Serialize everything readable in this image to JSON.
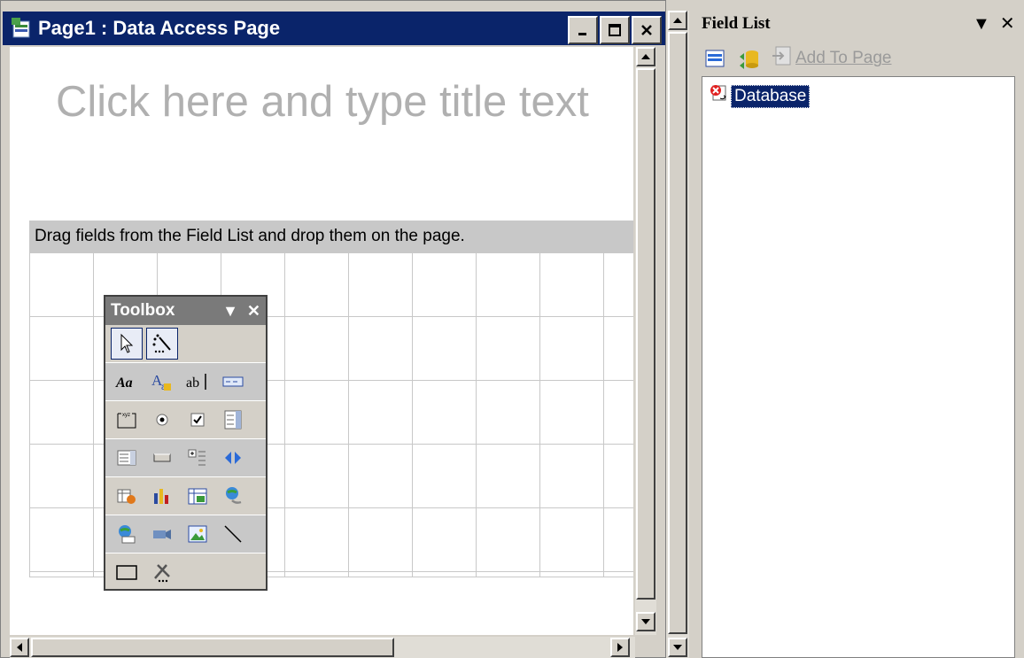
{
  "doc_window": {
    "title": "Page1 : Data Access Page",
    "title_placeholder": "Click here and type title text",
    "section_header": "Drag fields from the Field List and drop them on the page."
  },
  "toolbox": {
    "title": "Toolbox",
    "tools": [
      [
        "pointer-icon",
        "control-wizards-icon"
      ],
      [
        "label-icon",
        "bound-span-icon",
        "text-box-icon",
        "scrolling-text-icon"
      ],
      [
        "group-box-icon",
        "option-button-icon",
        "check-box-icon",
        "dropdown-list-icon"
      ],
      [
        "list-box-icon",
        "command-button-icon",
        "expand-icon",
        "record-navigation-icon"
      ],
      [
        "office-pivottable-icon",
        "office-chart-icon",
        "office-spreadsheet-icon",
        "hyperlink-icon"
      ],
      [
        "image-hyperlink-icon",
        "movie-icon",
        "image-icon",
        "line-icon"
      ],
      [
        "rectangle-icon",
        "more-controls-icon"
      ]
    ]
  },
  "field_list": {
    "title": "Field List",
    "add_to_page": "Add To Page",
    "tree": [
      {
        "label": "Database"
      }
    ]
  },
  "colors": {
    "titlebar": "#0a246a",
    "chrome": "#d4d0c8",
    "placeholder_text": "#b0b0b0",
    "section_header_bg": "#c8c8c8"
  }
}
